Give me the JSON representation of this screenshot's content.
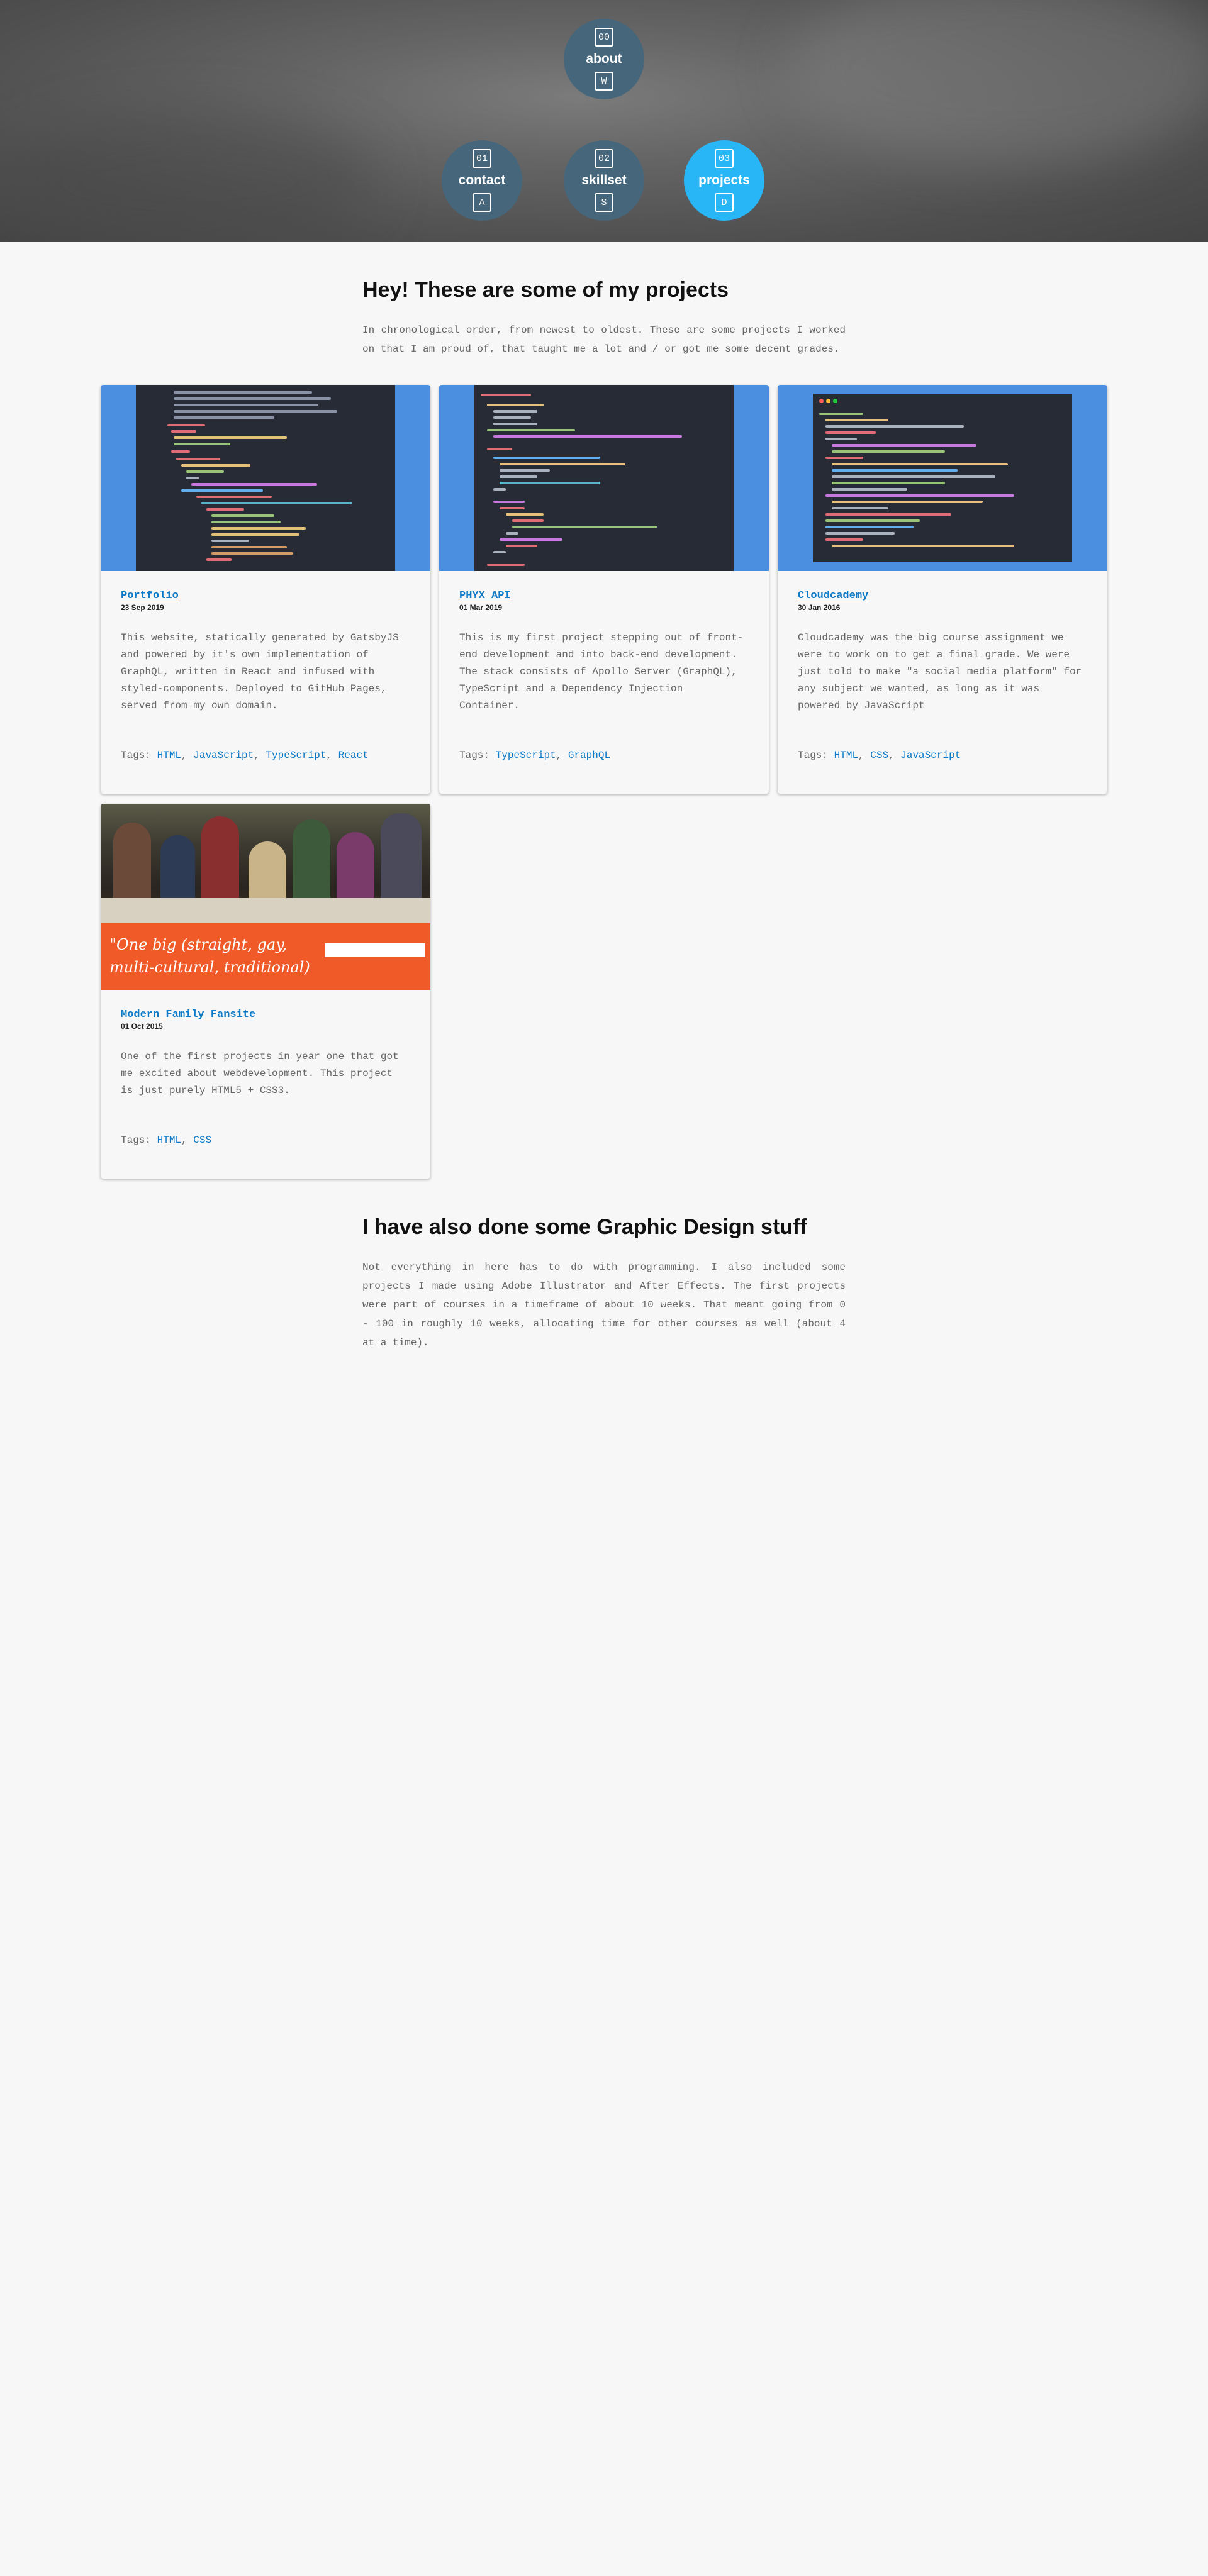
{
  "nav": {
    "about": {
      "key": "00",
      "label": "about",
      "shortcut": "W"
    },
    "contact": {
      "key": "01",
      "label": "contact",
      "shortcut": "A"
    },
    "skillset": {
      "key": "02",
      "label": "skillset",
      "shortcut": "S"
    },
    "projects": {
      "key": "03",
      "label": "projects",
      "shortcut": "D",
      "active": true
    }
  },
  "projects_section": {
    "title": "Hey! These are some of my projects",
    "intro": "In chronological order, from newest to oldest. These are some projects I worked on that I am proud of, that taught me a lot and / or got me some decent grades."
  },
  "projects": [
    {
      "title": "Portfolio",
      "date": "23 Sep 2019",
      "description": "This website, statically generated by GatsbyJS and powered by it's own implementation of GraphQL, written in React and infused with styled-components. Deployed to GitHub Pages, served from my own domain.",
      "tags_label": "Tags:",
      "tags": [
        "HTML",
        "JavaScript",
        "TypeScript",
        "React"
      ]
    },
    {
      "title": "PHYX API",
      "date": "01 Mar 2019",
      "description": "This is my first project stepping out of front-end development and into back-end development. The stack consists of Apollo Server (GraphQL), TypeScript and a Dependency Injection Container.",
      "tags_label": "Tags:",
      "tags": [
        "TypeScript",
        "GraphQL"
      ]
    },
    {
      "title": "Cloudcademy",
      "date": "30 Jan 2016",
      "description": "Cloudcademy was the big course assignment we were to work on to get a final grade. We were just told to make \"a social media platform\" for any subject we wanted, as long as it was powered by JavaScript",
      "tags_label": "Tags:",
      "tags": [
        "HTML",
        "CSS",
        "JavaScript"
      ]
    },
    {
      "title": "Modern Family Fansite",
      "date": "01 Oct 2015",
      "description": "One of the first projects in year one that got me excited about webdevelopment. This project is just purely HTML5 + CSS3.",
      "tags_label": "Tags:",
      "tags": [
        "HTML",
        "CSS"
      ],
      "thumb_quote_line1": "\"One big (straight, gay,",
      "thumb_quote_line2": "multi-cultural, traditional)"
    }
  ],
  "graphic_section": {
    "title": "I have also done some Graphic Design stuff",
    "intro": "Not everything in here has to do with programming. I also included some projects I made using Adobe Illustrator and After Effects. The first projects were part of courses in a timeframe of about 10 weeks. That meant going from 0 - 100 in roughly 10 weeks, allocating time for other courses as well (about 4 at a time)."
  },
  "colors": {
    "accent": "#29b6f6",
    "nav_circle": "#46667c",
    "link": "#0a7ac8",
    "thumb_blue": "#4a8fe0",
    "thumb_orange": "#f05a28"
  }
}
